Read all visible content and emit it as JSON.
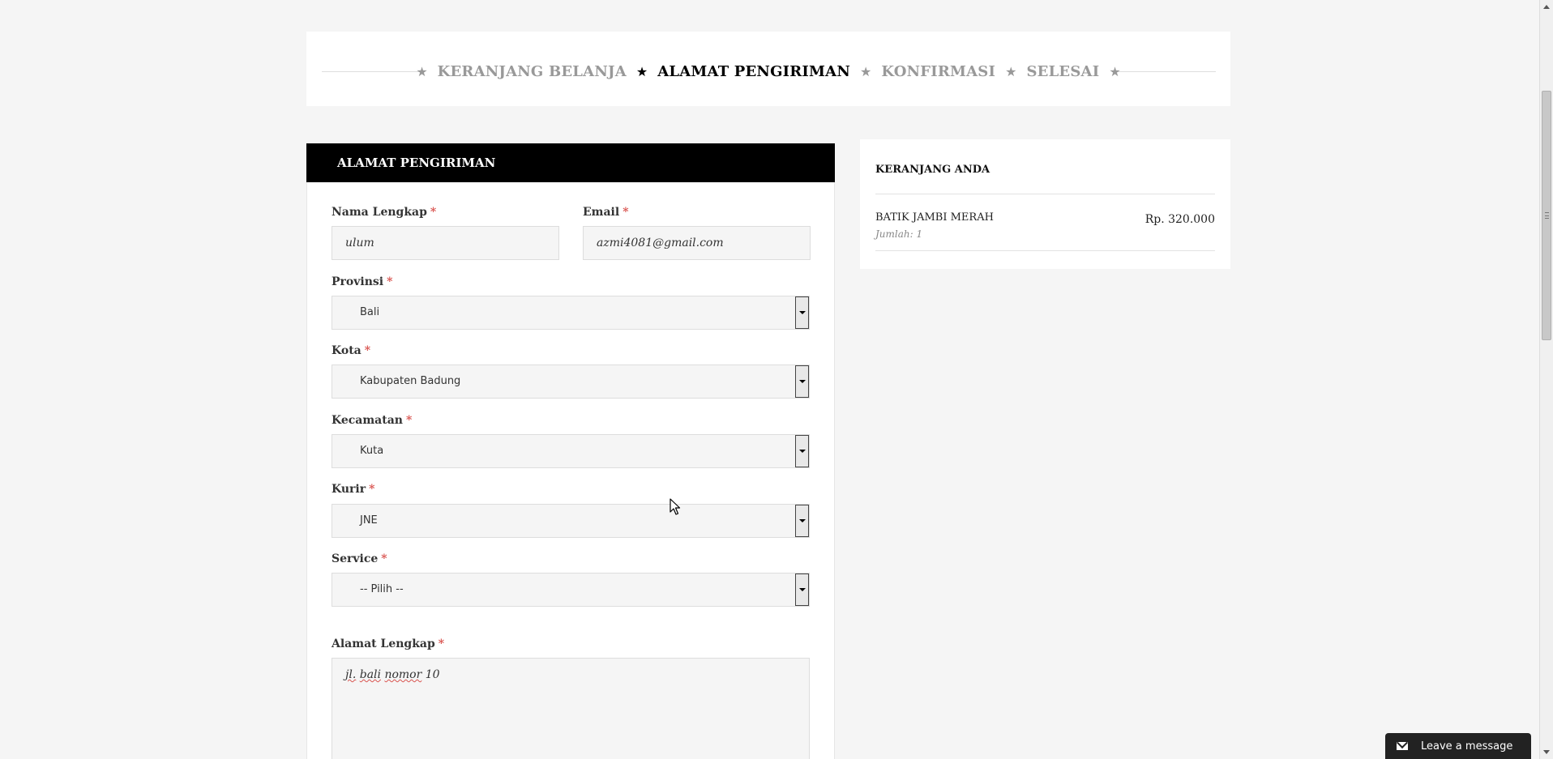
{
  "steps": {
    "items": [
      {
        "label": "KERANJANG BELANJA"
      },
      {
        "label": "ALAMAT PENGIRIMAN"
      },
      {
        "label": "KONFIRMASI"
      },
      {
        "label": "SELESAI"
      }
    ],
    "active_index": 1
  },
  "form": {
    "header": "ALAMAT PENGIRIMAN",
    "required_mark": "*",
    "nama": {
      "label": "Nama Lengkap",
      "value": "ulum"
    },
    "email": {
      "label": "Email",
      "value": "azmi4081@gmail.com"
    },
    "provinsi": {
      "label": "Provinsi",
      "value": "Bali"
    },
    "kota": {
      "label": "Kota",
      "value": "Kabupaten Badung"
    },
    "kecamatan": {
      "label": "Kecamatan",
      "value": "Kuta"
    },
    "kurir": {
      "label": "Kurir",
      "value": "JNE"
    },
    "service": {
      "label": "Service",
      "value": "-- Pilih --"
    },
    "alamat": {
      "label": "Alamat Lengkap",
      "value_parts": [
        "jl.",
        " ",
        "bali",
        " ",
        "nomor",
        " 10"
      ]
    }
  },
  "cart": {
    "title": "KERANJANG ANDA",
    "item": {
      "name": "BATIK JAMBI MERAH",
      "qty": "Jumlah: 1",
      "price": "Rp. 320.000"
    }
  },
  "chat": {
    "label": "Leave a message"
  },
  "colors": {
    "accent": "#000000",
    "required": "#d9534f",
    "inactive_step": "#999999"
  }
}
